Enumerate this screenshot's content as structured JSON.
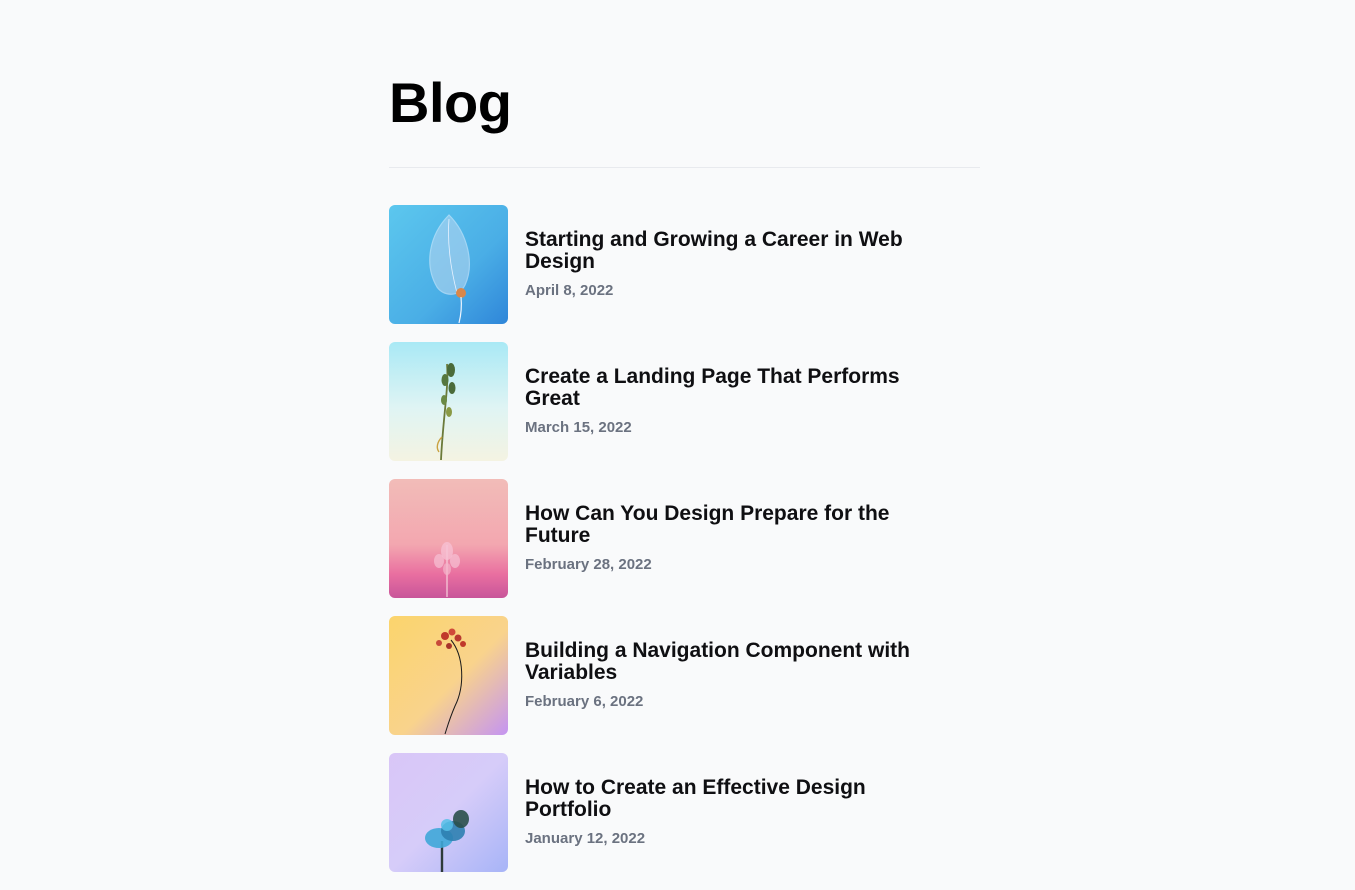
{
  "page": {
    "title": "Blog"
  },
  "posts": [
    {
      "title": "Starting and Growing a Career in Web Design",
      "date": "April 8, 2022",
      "thumbnail_icon": "leaf-image"
    },
    {
      "title": "Create a Landing Page That Performs Great",
      "date": "March 15, 2022",
      "thumbnail_icon": "plant-sprig-image"
    },
    {
      "title": "How Can You Design Prepare for the Future",
      "date": "February 28, 2022",
      "thumbnail_icon": "pink-plant-image"
    },
    {
      "title": "Building a Navigation Component with Variables",
      "date": "February 6, 2022",
      "thumbnail_icon": "flower-stem-image"
    },
    {
      "title": "How to Create an Effective Design Portfolio",
      "date": "January 12, 2022",
      "thumbnail_icon": "blue-tree-image"
    }
  ],
  "colors": {
    "background": "#f9fafb",
    "title_text": "#0f0f12",
    "date_text": "#6b7280",
    "divider": "#e8eaee"
  }
}
